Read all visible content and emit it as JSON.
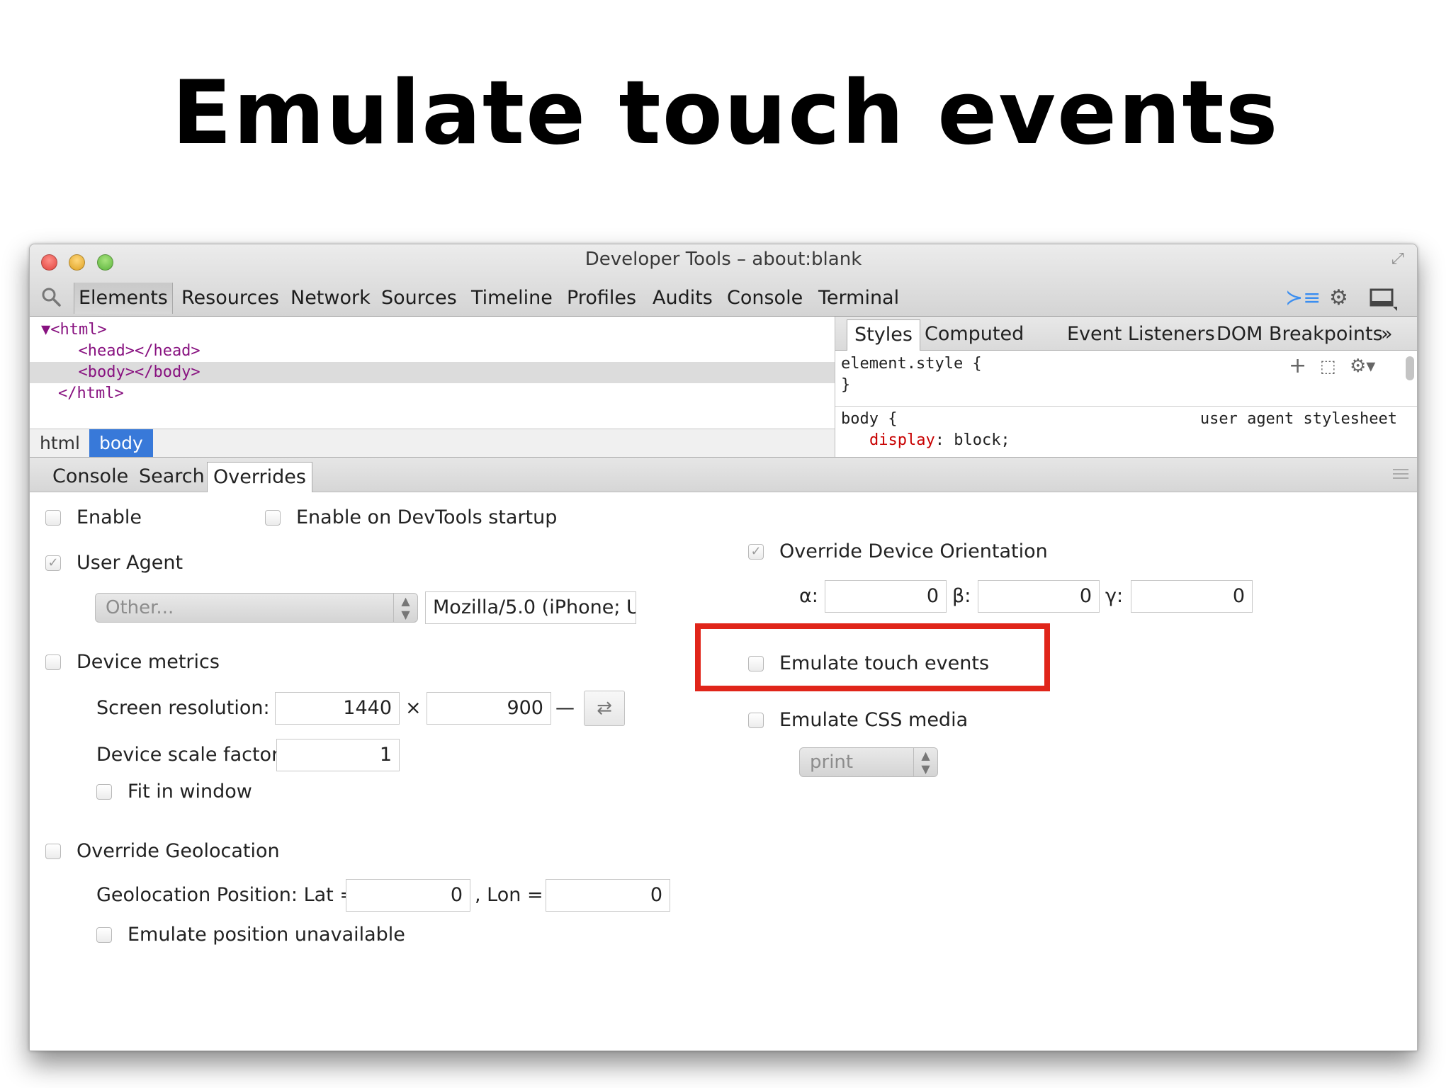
{
  "slide": {
    "title": "Emulate touch events"
  },
  "window": {
    "title": "Developer Tools – about:blank",
    "tabs": [
      "Elements",
      "Resources",
      "Network",
      "Sources",
      "Timeline",
      "Profiles",
      "Audits",
      "Console",
      "Terminal"
    ],
    "active_tab": "Elements"
  },
  "elements": {
    "dom": [
      "▼<html>",
      "  <head></head>",
      "  <body></body>",
      "</html>"
    ],
    "breadcrumbs": [
      "html",
      "body"
    ]
  },
  "styles": {
    "tabs": [
      "Styles",
      "Computed",
      "Event Listeners",
      "DOM Breakpoints",
      "»"
    ],
    "rules": {
      "element_open": "element.style {",
      "element_close": "}",
      "body_open": "body {",
      "body_source": "user agent stylesheet",
      "body_prop": "display",
      "body_value": ": block;"
    }
  },
  "drawer": {
    "tabs": [
      "Console",
      "Search",
      "Overrides"
    ],
    "active_tab": "Overrides"
  },
  "overrides": {
    "enable": {
      "label": "Enable",
      "checked": false
    },
    "enable_startup": {
      "label": "Enable on DevTools startup",
      "checked": false
    },
    "user_agent": {
      "label": "User Agent",
      "checked": true,
      "select_value": "Other...",
      "value": "Mozilla/5.0 (iPhone; U"
    },
    "device_metrics": {
      "label": "Device metrics",
      "checked": false,
      "resolution_label": "Screen resolution:",
      "width": "1440",
      "times": "×",
      "height": "900",
      "dash": "—",
      "swap": "⇄",
      "scale_label": "Device scale factor:",
      "scale": "1",
      "fit_label": "Fit in window"
    },
    "geolocation": {
      "label": "Override Geolocation",
      "position_label": "Geolocation Position: Lat =",
      "lat": "0",
      "lon_label": ", Lon =",
      "lon": "0",
      "unavailable_label": "Emulate position unavailable"
    },
    "orientation": {
      "label": "Override Device Orientation",
      "checked": true,
      "alpha_label": "α:",
      "alpha": "0",
      "beta_label": "β:",
      "beta": "0",
      "gamma_label": "γ:",
      "gamma": "0"
    },
    "touch": {
      "label": "Emulate touch events",
      "checked": false
    },
    "css_media": {
      "label": "Emulate CSS media",
      "checked": false,
      "select_value": "print"
    }
  },
  "colors": {
    "highlight": "#e0251a",
    "breadcrumb_active": "#3879d9",
    "css_property": "#c80000"
  }
}
